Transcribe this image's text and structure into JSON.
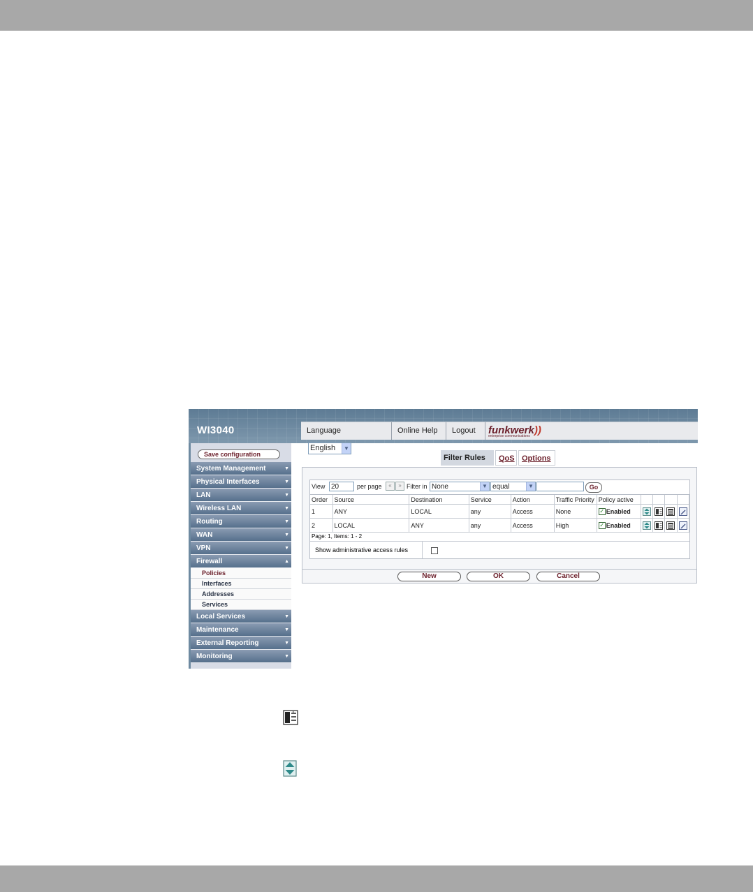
{
  "header": {
    "model": "WI3040",
    "language_label": "Language",
    "language_value": "English",
    "online_help": "Online Help",
    "logout": "Logout",
    "logo": "funkwerk",
    "logo_tagline": "enterprise communications"
  },
  "sidebar": {
    "save_label": "Save configuration",
    "items": [
      {
        "label": "System Management"
      },
      {
        "label": "Physical Interfaces"
      },
      {
        "label": "LAN"
      },
      {
        "label": "Wireless LAN"
      },
      {
        "label": "Routing"
      },
      {
        "label": "WAN"
      },
      {
        "label": "VPN"
      },
      {
        "label": "Firewall"
      },
      {
        "label": "Local Services"
      },
      {
        "label": "Maintenance"
      },
      {
        "label": "External Reporting"
      },
      {
        "label": "Monitoring"
      }
    ],
    "firewall_sub": [
      "Policies",
      "Interfaces",
      "Addresses",
      "Services"
    ]
  },
  "tabs": [
    "Filter Rules",
    "QoS",
    "Options"
  ],
  "toolbar": {
    "view_label": "View",
    "view_value": "20",
    "per_page": "per page",
    "prev": "«",
    "next": "»",
    "filter_label": "Filter in",
    "filter_field": "None",
    "filter_op": "equal",
    "filter_value": "",
    "go": "Go"
  },
  "table": {
    "headers": [
      "Order",
      "Source",
      "Destination",
      "Service",
      "Action",
      "Traffic Priority",
      "Policy active"
    ],
    "rows": [
      {
        "order": "1",
        "source": "ANY",
        "destination": "LOCAL",
        "service": "any",
        "action": "Access",
        "priority": "None",
        "active": "Enabled"
      },
      {
        "order": "2",
        "source": "LOCAL",
        "destination": "ANY",
        "service": "any",
        "action": "Access",
        "priority": "High",
        "active": "Enabled"
      }
    ],
    "page_info": "Page: 1, Items: 1 - 2"
  },
  "admin_rules_label": "Show administrative access rules",
  "buttons": {
    "new": "New",
    "ok": "OK",
    "cancel": "Cancel"
  },
  "colors": {
    "accent": "#6b1f2a",
    "header": "#6e8aa1",
    "menu": "#56708c"
  }
}
